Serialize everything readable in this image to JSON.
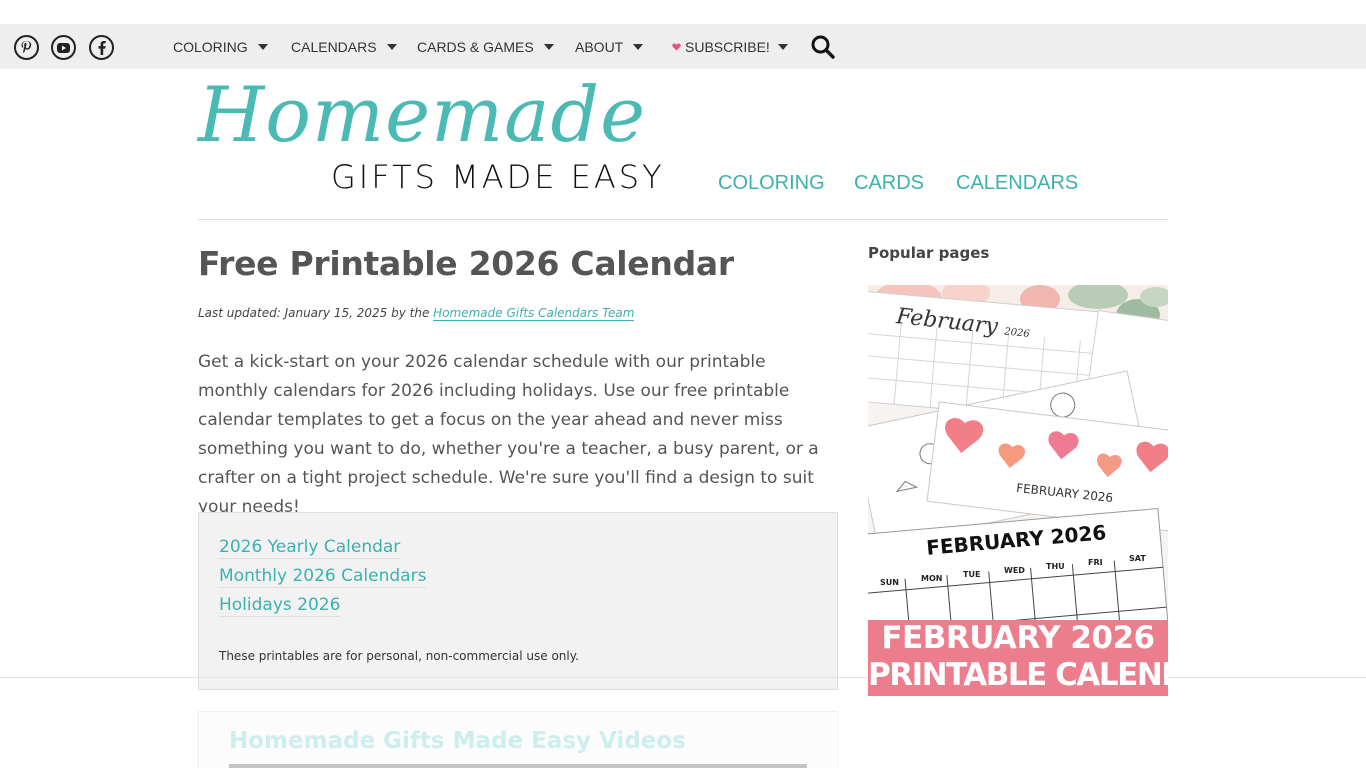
{
  "topbar": {
    "social": [
      "pinterest-icon",
      "youtube-icon",
      "facebook-icon"
    ],
    "menu": [
      {
        "label": "COLORING"
      },
      {
        "label": "CALENDARS"
      },
      {
        "label": "CARDS & GAMES"
      },
      {
        "label": "ABOUT"
      },
      {
        "label": "SUBSCRIBE!"
      }
    ],
    "search_icon": "search-icon"
  },
  "header": {
    "logo_script": "Homemade",
    "logo_sub": "GIFTS MADE EASY",
    "nav": [
      "COLORING",
      "CARDS",
      "CALENDARS"
    ]
  },
  "main": {
    "title": "Free Printable 2026 Calendar",
    "byline_prefix": "Last updated: January 15, 2025 by the ",
    "byline_author": "Homemade Gifts Calendars Team",
    "intro": "Get a kick-start on your 2026 calendar schedule with our printable monthly calendars for 2026 including holidays. Use our free printable calendar templates to get a focus on the year ahead and never miss something you want to do, whether you're a teacher, a busy parent, or a crafter on a tight project schedule. We're sure you'll find a design to suit your needs!",
    "toc": [
      "2026 Yearly Calendar",
      "Monthly 2026 Calendars",
      "Holidays 2026"
    ],
    "toc_note": "These printables are for personal, non-commercial use only.",
    "videos_title": "Homemade Gifts Made Easy Videos"
  },
  "sidebar": {
    "title": "Popular pages",
    "promo": {
      "script_text": "February",
      "script_year": "2026",
      "strip_text": "FEBRUARY 2026",
      "calendar_heading": "FEBRUARY 2026",
      "days": [
        "SUN",
        "MON",
        "TUE",
        "WED",
        "THU",
        "FRI",
        "SAT"
      ],
      "banner_line1": "FEBRUARY 2026",
      "banner_line2": "PRINTABLE CALENDARS"
    }
  },
  "colors": {
    "accent": "#3bb2ad",
    "banner": "#ec7d8c",
    "topbar": "#eeeeee"
  }
}
